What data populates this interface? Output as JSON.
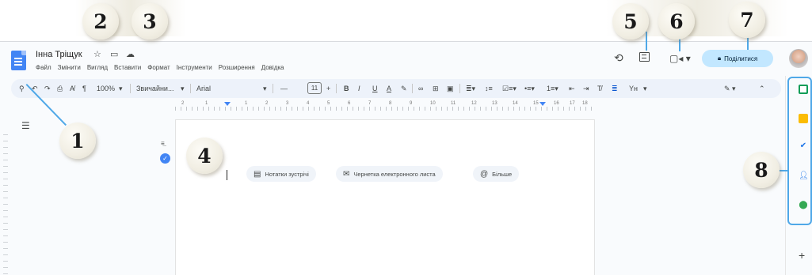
{
  "callouts": [
    "1",
    "2",
    "3",
    "4",
    "5",
    "6",
    "7",
    "8"
  ],
  "doc": {
    "title": "Інна Тріщук",
    "title_icons": [
      "star-icon",
      "folder-icon",
      "cloud-icon"
    ],
    "menu": [
      "Файл",
      "Змінити",
      "Вигляд",
      "Вставити",
      "Формат",
      "Інструменти",
      "Розширення",
      "Довідка"
    ]
  },
  "header": {
    "share_label": "Поділитися",
    "share_icon": "lock-icon",
    "history_icon": "history-icon",
    "comment_icon": "comment-icon",
    "meet_icon": "video-call-icon"
  },
  "toolbar": {
    "zoom": "100%",
    "style": "Звичайни...",
    "font": "Arial",
    "font_size": "11",
    "bold": "B",
    "italic": "I",
    "underline": "U",
    "text_color": "A",
    "input_tools": "Yн",
    "minus": "—",
    "plus": "+"
  },
  "ruler": {
    "labels": [
      "2",
      "1",
      "1",
      "2",
      "3",
      "4",
      "5",
      "6",
      "7",
      "8",
      "9",
      "10",
      "11",
      "12",
      "13",
      "14",
      "15",
      "16",
      "17",
      "18"
    ]
  },
  "page": {
    "chips": [
      {
        "icon": "doc-icon",
        "label": "Нотатки зустрічі"
      },
      {
        "icon": "mail-icon",
        "label": "Чернетка електронного листа"
      },
      {
        "icon": "at-icon",
        "label": "Більше"
      }
    ]
  },
  "side_panel": {
    "icons": [
      "sheets-icon",
      "keep-icon",
      "tasks-icon",
      "contacts-icon",
      "maps-icon"
    ],
    "add": "+"
  },
  "colors": {
    "accent": "#4285f4",
    "callout_line": "#4fa8e8",
    "share_bg": "#c2e7ff",
    "toolbar_bg": "#edf2fa"
  }
}
